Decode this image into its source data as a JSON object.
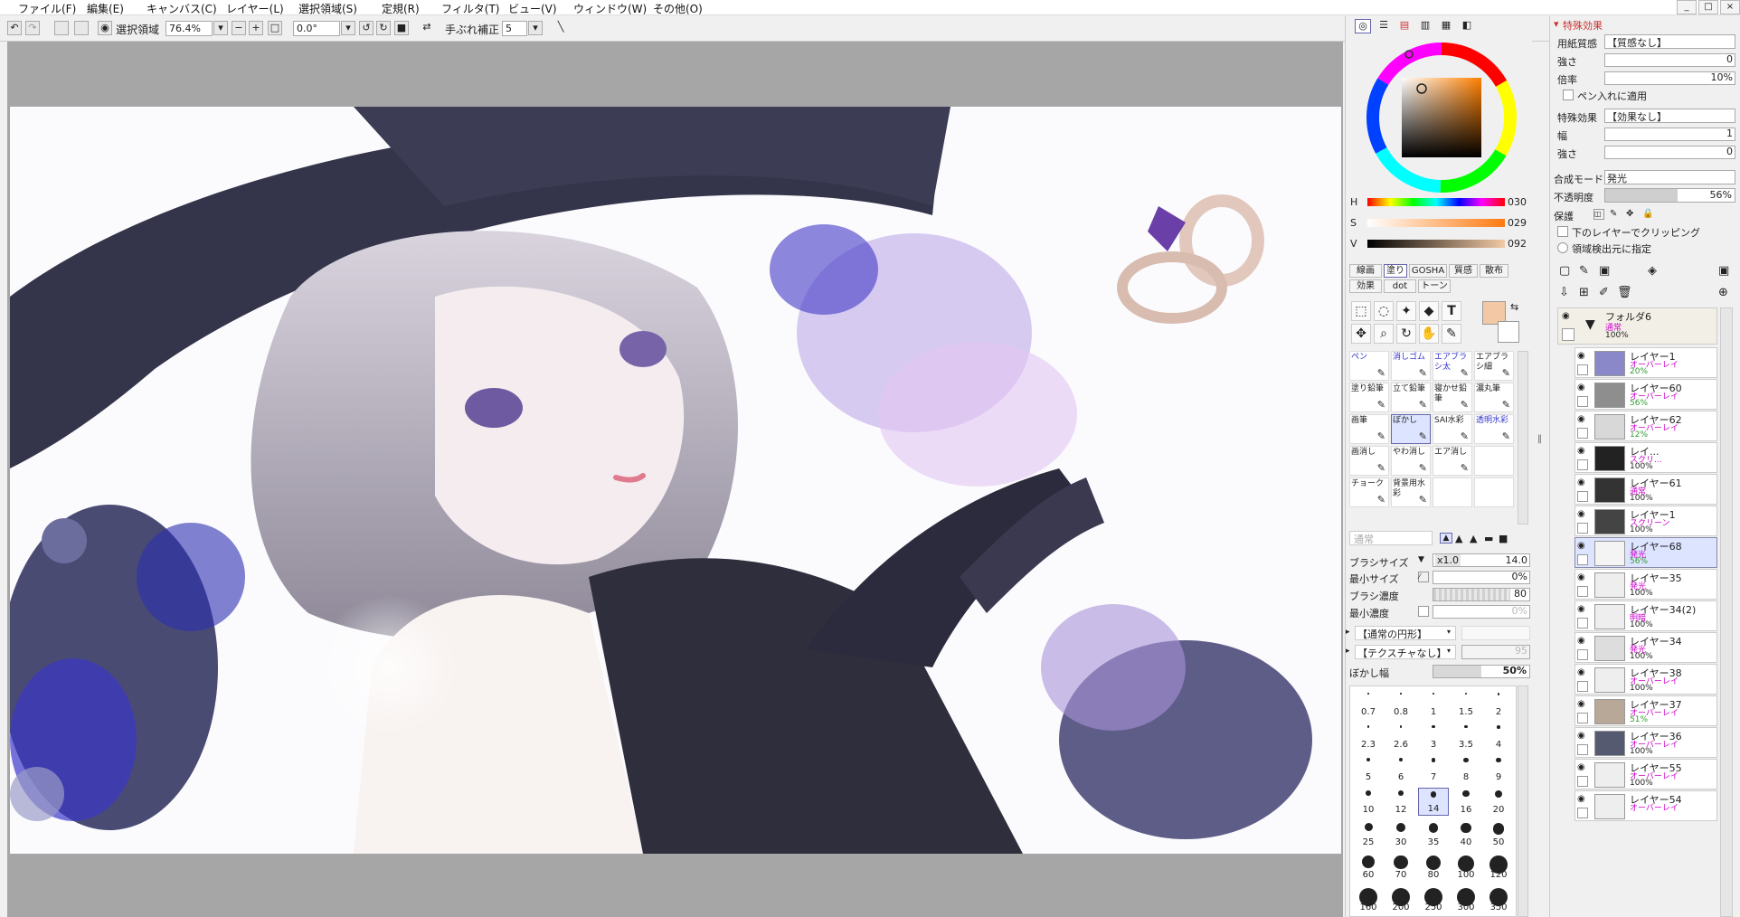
{
  "menu": [
    "ファイル(F)",
    "編集(E)",
    "キャンバス(C)",
    "レイヤー(L)",
    "選択領域(S)",
    "定規(R)",
    "フィルタ(T)",
    "ビュー(V)",
    "ウィンドウ(W)",
    "その他(O)"
  ],
  "window_controls": [
    "_",
    "□",
    "×"
  ],
  "toolbar": {
    "selection_label": "選択領域",
    "zoom": "76.4%",
    "rotation": "0.0°",
    "stabilizer_label": "手ぶれ補正",
    "stabilizer_value": "5"
  },
  "color": {
    "h_label": "H",
    "h_value": "030",
    "s_label": "S",
    "s_value": "029",
    "v_label": "V",
    "v_value": "092",
    "swatch": "#f2c9a4"
  },
  "tool_tabs_row1": [
    "線画",
    "塗り",
    "GOSHA",
    "質感",
    "散布"
  ],
  "tool_tabs_row2": [
    "効果",
    "dot",
    "トーン"
  ],
  "brushes": [
    {
      "name": "ペン",
      "color": "#33c"
    },
    {
      "name": "消しゴム",
      "color": "#33c"
    },
    {
      "name": "エアブラシ太",
      "color": "#33c"
    },
    {
      "name": "エアブラシ細",
      "color": "#222"
    },
    {
      "name": "塗り鉛筆",
      "color": "#222"
    },
    {
      "name": "立て鉛筆",
      "color": "#222"
    },
    {
      "name": "寝かせ鉛筆",
      "color": "#222"
    },
    {
      "name": "濃丸筆",
      "color": "#222"
    },
    {
      "name": "画筆",
      "color": "#222"
    },
    {
      "name": "ぼかし",
      "color": "#222"
    },
    {
      "name": "SAI水彩",
      "color": "#222"
    },
    {
      "name": "透明水彩",
      "color": "#33c"
    },
    {
      "name": "画消し",
      "color": "#222"
    },
    {
      "name": "やわ消し",
      "color": "#222"
    },
    {
      "name": "エア消し",
      "color": "#222"
    },
    {
      "name": "",
      "color": "#222"
    },
    {
      "name": "チョーク",
      "color": "#222"
    },
    {
      "name": "背景用水彩",
      "color": "#222"
    },
    {
      "name": "",
      "color": "#222"
    },
    {
      "name": "",
      "color": "#222"
    }
  ],
  "brush_settings": {
    "blend_mode": "通常",
    "size_label": "ブラシサイズ",
    "size_mult": "x1.0",
    "size_value": "14.0",
    "min_size_label": "最小サイズ",
    "min_size_value": "0%",
    "density_label": "ブラシ濃度",
    "density_value": "80",
    "min_density_label": "最小濃度",
    "min_density_value": "0%",
    "shape_label": "【通常の円形】",
    "texture_label": "【テクスチャなし】",
    "texture_value": "95",
    "blur_label": "ぼかし幅",
    "blur_value": "50%",
    "blur_fraction": 0.5,
    "density_fraction": 0.8
  },
  "brush_sizes": [
    "0.7",
    "0.8",
    "1",
    "1.5",
    "2",
    "2.3",
    "2.6",
    "3",
    "3.5",
    "4",
    "5",
    "6",
    "7",
    "8",
    "9",
    "10",
    "12",
    "14",
    "16",
    "20",
    "25",
    "30",
    "35",
    "40",
    "50",
    "60",
    "70",
    "80",
    "100",
    "120",
    "160",
    "200",
    "250",
    "300",
    "350"
  ],
  "selected_size": "14",
  "effects": {
    "section_title": "特殊効果",
    "paper_label": "用紙質感",
    "paper_value": "【質感なし】",
    "strength_label": "強さ",
    "strength_value": "0",
    "scale_label": "倍率",
    "scale_value": "10%",
    "pen_apply_label": "ペン入れに適用",
    "effect_label": "特殊効果",
    "effect_value": "【効果なし】",
    "width_label": "幅",
    "width_value": "1",
    "strength2_label": "強さ",
    "strength2_value": "0"
  },
  "layer_props": {
    "blend_label": "合成モード",
    "blend_value": "発光",
    "opacity_label": "不透明度",
    "opacity_value": "56%",
    "opacity_fraction": 0.56,
    "protect_label": "保護",
    "clip_label": "下のレイヤーでクリッピング",
    "select_source_label": "領域検出元に指定"
  },
  "folder": {
    "name": "フォルダ6",
    "mode": "通常",
    "opacity": "100%"
  },
  "layers": [
    {
      "name": "レイヤー1",
      "mode": "オーバーレイ",
      "opacity": "20%",
      "thumb": "#8a88c8",
      "opacity_color": "#393"
    },
    {
      "name": "レイヤー60",
      "mode": "オーバーレイ",
      "opacity": "56%",
      "thumb": "#8e8e8e",
      "opacity_color": "#393"
    },
    {
      "name": "レイヤー62",
      "mode": "オーバーレイ",
      "opacity": "12%",
      "thumb": "#d8d8d8",
      "opacity_color": "#393"
    },
    {
      "name": "レイ...",
      "mode": "スクリ...",
      "opacity": "100%",
      "thumb": "#222",
      "opacity_color": "#222"
    },
    {
      "name": "レイヤー61",
      "mode": "通常",
      "opacity": "100%",
      "thumb": "#333",
      "opacity_color": "#222"
    },
    {
      "name": "レイヤー1",
      "mode": "スクリーン",
      "opacity": "100%",
      "thumb": "#444",
      "opacity_color": "#222"
    },
    {
      "name": "レイヤー68",
      "mode": "発光",
      "opacity": "56%",
      "thumb": "#f4f4f4",
      "opacity_color": "#393"
    },
    {
      "name": "レイヤー35",
      "mode": "発光",
      "opacity": "100%",
      "thumb": "#eee",
      "opacity_color": "#222"
    },
    {
      "name": "レイヤー34(2)",
      "mode": "明暗",
      "opacity": "100%",
      "thumb": "#eee",
      "opacity_color": "#222"
    },
    {
      "name": "レイヤー34",
      "mode": "発光",
      "opacity": "100%",
      "thumb": "#ddd",
      "opacity_color": "#222"
    },
    {
      "name": "レイヤー38",
      "mode": "オーバーレイ",
      "opacity": "100%",
      "thumb": "#eee",
      "opacity_color": "#222"
    },
    {
      "name": "レイヤー37",
      "mode": "オーバーレイ",
      "opacity": "51%",
      "thumb": "#b8a898",
      "opacity_color": "#393"
    },
    {
      "name": "レイヤー36",
      "mode": "オーバーレイ",
      "opacity": "100%",
      "thumb": "#555a70",
      "opacity_color": "#222"
    },
    {
      "name": "レイヤー55",
      "mode": "オーバーレイ",
      "opacity": "100%",
      "thumb": "#eee",
      "opacity_color": "#222"
    },
    {
      "name": "レイヤー54",
      "mode": "オーバーレイ",
      "opacity": "",
      "thumb": "#eee",
      "opacity_color": "#222"
    }
  ],
  "selected_layer": "レイヤー68"
}
